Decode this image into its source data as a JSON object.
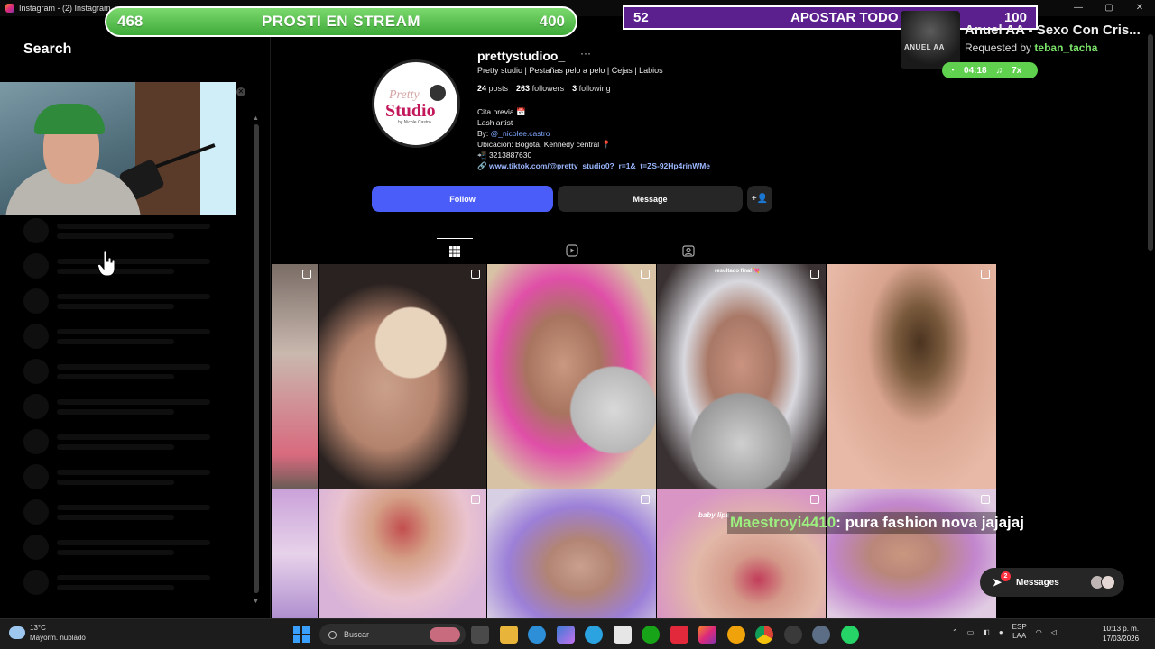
{
  "window": {
    "tab_title": "Instagram - (2) Instagram"
  },
  "left_panel": {
    "title": "Search"
  },
  "overlays": {
    "green_bar": {
      "left_value": "468",
      "title": "PROSTI EN STREAM",
      "right_value": "400"
    },
    "purple_bar": {
      "left_value": "52",
      "title": "APOSTAR TODO",
      "right_value": "100"
    },
    "song": {
      "thumb_text": "ANUEL AA",
      "title": "Anuel AA - Sexo Con Cris...",
      "requested_label": "Requested by",
      "requested_user": "teban_tacha",
      "time": "04:18",
      "count": "7x"
    },
    "chat": {
      "user": "Maestroyi4410",
      "message": " : pura fashion nova jajajaj"
    }
  },
  "profile": {
    "username": "prettystudioo_",
    "more": "···",
    "tagline": "Pretty studio | Pestañas pelo a pelo | Cejas | Labios",
    "posts_count": "24",
    "posts_label": "posts",
    "followers_count": "263",
    "followers_label": "followers",
    "following_count": "3",
    "following_label": "following",
    "bio": {
      "line1": "Cita previa 📅",
      "line2": "Lash artist",
      "line3_prefix": "By: ",
      "line3_mention": "@_nicolee.castro",
      "line4": "Ubicación: Bogotá, Kennedy central 📍",
      "line5": "📲 3213887630",
      "link": "www.tiktok.com/@pretty_studio0?_r=1&_t=ZS-92Hp4rinWMe"
    },
    "follow_label": "Follow",
    "message_label": "Message"
  },
  "grid": {
    "labels": {
      "post_4": "resultado final 💘",
      "post_8": "baby lips"
    }
  },
  "messages_pill": {
    "label": "Messages",
    "badge": "2"
  },
  "taskbar": {
    "weather_temp": "13°C",
    "weather_desc": "Mayorm. nublado",
    "search_placeholder": "Buscar",
    "lang_top": "ESP",
    "lang_bottom": "LAA",
    "time": "10:13 p. m.",
    "date": "17/03/2026"
  },
  "colors": {
    "follow_button": "#4a5df9",
    "green_bar": "#3faa3a",
    "purple_bar": "#5b1f8e",
    "chat_user": "#9cf07f"
  }
}
